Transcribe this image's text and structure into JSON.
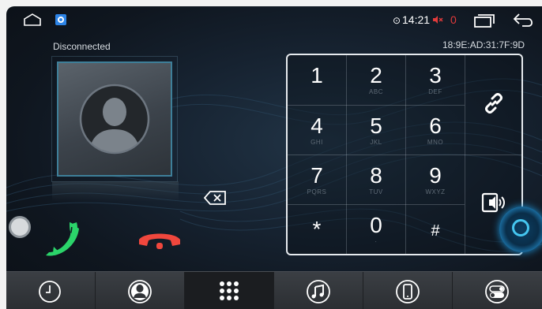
{
  "status_bar": {
    "time": "14:21",
    "volume": "0",
    "icons": [
      "home-icon",
      "app-badge-icon",
      "location-icon",
      "mute-icon",
      "recent-apps-icon",
      "back-icon"
    ]
  },
  "call_panel": {
    "connection_status": "Disconnected",
    "device_mac": "18:9E:AD:31:7F:9D",
    "icons": [
      "contact-silhouette-icon",
      "backspace-icon",
      "answer-call-icon",
      "hang-up-icon"
    ]
  },
  "keypad": {
    "keys": [
      {
        "digit": "1",
        "letters": ""
      },
      {
        "digit": "2",
        "letters": "ABC"
      },
      {
        "digit": "3",
        "letters": "DEF"
      },
      {
        "digit": "4",
        "letters": "GHI"
      },
      {
        "digit": "5",
        "letters": "JKL"
      },
      {
        "digit": "6",
        "letters": "MNO"
      },
      {
        "digit": "7",
        "letters": "PQRS"
      },
      {
        "digit": "8",
        "letters": "TUV"
      },
      {
        "digit": "9",
        "letters": "WXYZ"
      },
      {
        "digit": "*",
        "letters": ""
      },
      {
        "digit": "0",
        "letters": "·"
      },
      {
        "digit": "#",
        "letters": ""
      }
    ],
    "side_icons": [
      "link-icon",
      "audio-transfer-icon"
    ]
  },
  "bottom_tabs": [
    {
      "icon": "call-history-icon",
      "active": false
    },
    {
      "icon": "contacts-icon",
      "active": false
    },
    {
      "icon": "dialpad-icon",
      "active": true
    },
    {
      "icon": "music-icon",
      "active": false
    },
    {
      "icon": "phone-device-icon",
      "active": false
    },
    {
      "icon": "settings-toggle-icon",
      "active": false
    }
  ],
  "colors": {
    "answer": "#2bd46a",
    "hangup": "#f0473d",
    "accent": "#3e7f99",
    "volume": "#e23b3b"
  }
}
